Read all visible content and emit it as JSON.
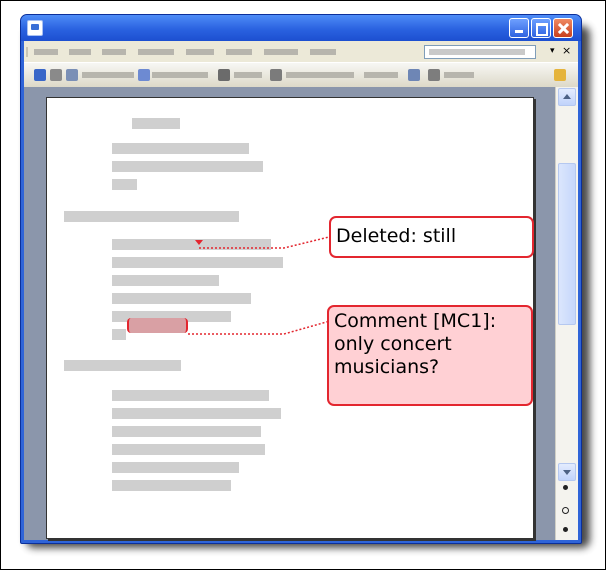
{
  "window": {
    "title": ""
  },
  "balloons": {
    "deleted_text": "Deleted: still",
    "comment_label": "Comment [MC1]:",
    "comment_line1": "only concert",
    "comment_line2": "musicians?"
  },
  "help_box": {
    "dropdown_symbol": "▾",
    "close_symbol": "×"
  },
  "colors": {
    "window_frame": "#2f64d8",
    "revision_red": "#e3262f",
    "comment_fill": "#ffd0d4",
    "redacted_text": "#cfcfcf"
  },
  "icons": [
    "app-icon",
    "minimize-icon",
    "maximize-icon",
    "close-icon",
    "save-icon",
    "print-icon",
    "find-icon",
    "scroll-up-icon",
    "scroll-down-icon",
    "browse-object-icon"
  ]
}
